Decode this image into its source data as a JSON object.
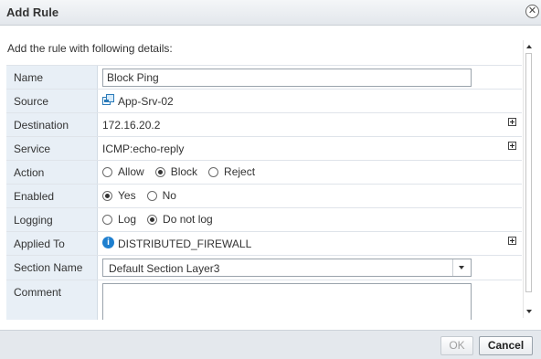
{
  "dialog": {
    "title": "Add Rule",
    "intro": "Add the rule with following details:"
  },
  "fields": {
    "name": {
      "label": "Name",
      "value": "Block Ping"
    },
    "source": {
      "label": "Source",
      "value": "App-Srv-02",
      "icon": "vm-icon"
    },
    "destination": {
      "label": "Destination",
      "value": "172.16.20.2"
    },
    "service": {
      "label": "Service",
      "value": "ICMP:echo-reply"
    },
    "action": {
      "label": "Action",
      "options": [
        "Allow",
        "Block",
        "Reject"
      ],
      "selected": "Block"
    },
    "enabled": {
      "label": "Enabled",
      "options": [
        "Yes",
        "No"
      ],
      "selected": "Yes"
    },
    "logging": {
      "label": "Logging",
      "options": [
        "Log",
        "Do not log"
      ],
      "selected": "Do not log"
    },
    "applied_to": {
      "label": "Applied To",
      "value": "DISTRIBUTED_FIREWALL",
      "icon": "info-icon"
    },
    "section_name": {
      "label": "Section Name",
      "value": "Default Section Layer3"
    },
    "comment": {
      "label": "Comment",
      "value": ""
    }
  },
  "footer": {
    "ok_label": "OK",
    "cancel_label": "Cancel"
  },
  "colors": {
    "label_bg": "#e8eff6",
    "info_blue": "#1e7fcf"
  }
}
